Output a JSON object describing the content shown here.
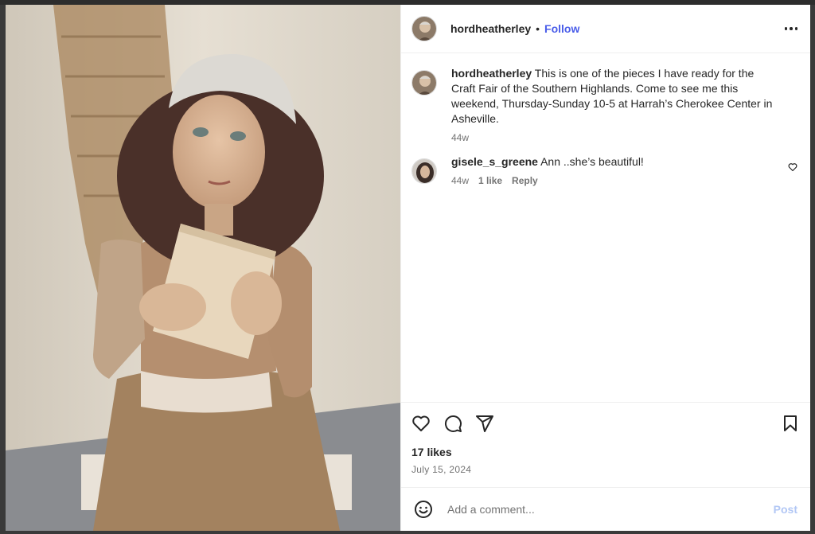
{
  "post": {
    "username": "hordheatherley",
    "follow_label": "Follow",
    "separator": "•"
  },
  "caption": {
    "username": "hordheatherley",
    "text": "This is one of the pieces I have ready for the Craft Fair of the Southern Highlands. Come to see me this weekend, Thursday-Sunday 10-5 at Harrah’s Cherokee Center in Asheville.",
    "time": "44w"
  },
  "comments": [
    {
      "username": "gisele_s_greene",
      "text": "Ann ..she’s beautiful!",
      "time": "44w",
      "likes": "1 like",
      "reply": "Reply"
    }
  ],
  "engagement": {
    "likes": "17 likes",
    "date": "July 15, 2024"
  },
  "composer": {
    "placeholder": "Add a comment...",
    "post_label": "Post"
  },
  "icons": [
    "like-icon",
    "comment-icon",
    "share-icon",
    "save-icon",
    "more-options-icon",
    "emoji-icon",
    "heart-icon"
  ],
  "colors": {
    "accent": "#4a5de9",
    "post_disabled": "#b2c7f5",
    "text": "#262626",
    "muted": "#737373"
  }
}
